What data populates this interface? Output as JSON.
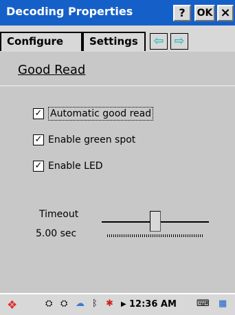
{
  "title_bar": {
    "title": "Decoding Properties",
    "help_label": "?",
    "ok_label": "OK",
    "close_label": "×"
  },
  "tabs": [
    {
      "label": "Configure"
    },
    {
      "label": "Settings"
    }
  ],
  "tab_arrows": {
    "left": "⇦",
    "right": "⇨"
  },
  "section": {
    "title": "Good Read"
  },
  "checkboxes": [
    {
      "label": "Automatic good read",
      "checked": true
    },
    {
      "label": "Enable green spot",
      "checked": true
    },
    {
      "label": "Enable LED",
      "checked": true
    }
  ],
  "timeout": {
    "label": "Timeout",
    "value_text": "5.00 sec",
    "slider_fraction": 0.5
  },
  "taskbar": {
    "clock": "12:36 AM"
  },
  "colors": {
    "titlebar": "#1560c8",
    "arrow": "#2fbfc0"
  }
}
